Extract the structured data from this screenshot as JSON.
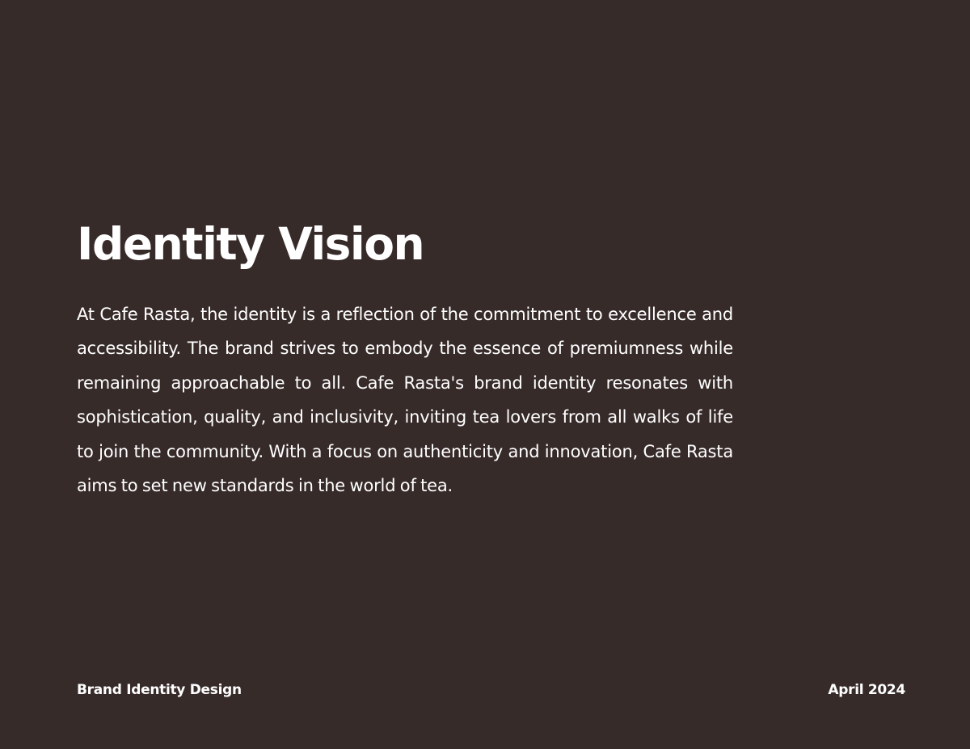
{
  "page": {
    "background_color": "#372b2a",
    "text_color": "#ffffff"
  },
  "section": {
    "title": "Identity Vision",
    "body": "At Cafe Rasta, the identity is a reflection of the commitment to excellence and accessibility. The brand strives to embody the essence of premiumness while remaining approachable to all. Cafe Rasta's brand identity resonates with sophistication, quality, and inclusivity, inviting tea lovers from all walks of life to join the community. With a focus on authenticity and innovation, Cafe Rasta aims to set new standards in the world of tea."
  },
  "footer": {
    "left_label": "Brand Identity Design",
    "right_label": "April 2024"
  }
}
